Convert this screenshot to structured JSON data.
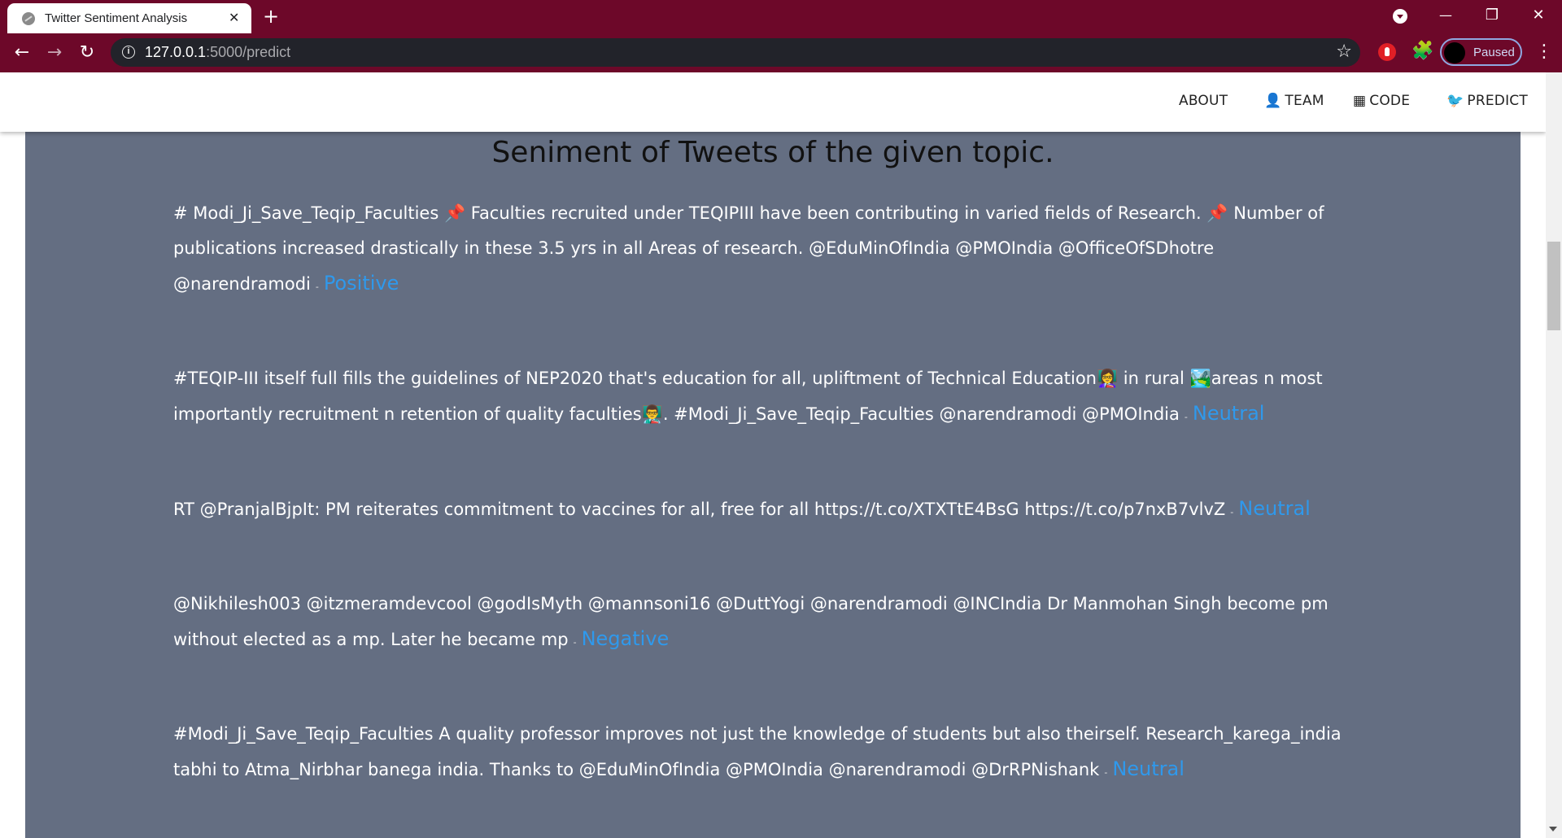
{
  "browser": {
    "tab_title": "Twitter Sentiment Analysis",
    "tab_close": "✕",
    "new_tab": "+",
    "url_host": "127.0.0.1",
    "url_path": ":5000/predict",
    "profile_label": "Paused",
    "icons": {
      "back": "←",
      "forward": "→",
      "reload": "↻",
      "star": "☆",
      "puzzle": "🧩",
      "menu": "⋮",
      "minimize": "—",
      "maximize": "❐",
      "close": "✕"
    }
  },
  "nav": {
    "about": "ABOUT",
    "team": "TEAM",
    "code": "CODE",
    "predict": "PREDICT",
    "icons": {
      "team": "👤",
      "code": "▦",
      "predict": "🐦"
    }
  },
  "page": {
    "heading": "Seniment of Tweets of the given topic."
  },
  "tweets": [
    {
      "text": "# Modi_Ji_Save_Teqip_Faculties 📌 Faculties recruited under TEQIPIII have been contributing in varied fields of Research. 📌 Number of publications increased drastically in these 3.5 yrs in all Areas of research. @EduMinOfIndia @PMOIndia @OfficeOfSDhotre @narendramodi",
      "sentiment": "Positive"
    },
    {
      "text": "#TEQIP-III itself full fills the guidelines of NEP2020 that's education for all, upliftment of Technical Education👩‍🏫 in rural 🏞️areas n most importantly recruitment n retention of quality faculties👨‍🏫. #Modi_Ji_Save_Teqip_Faculties @narendramodi @PMOIndia",
      "sentiment": "Neutral"
    },
    {
      "text": "RT @PranjalBjpIt: PM reiterates commitment to vaccines for all, free for all https://t.co/XTXTtE4BsG https://t.co/p7nxB7vlvZ",
      "sentiment": "Neutral"
    },
    {
      "text": "@Nikhilesh003 @itzmeramdevcool @godIsMyth @mannsoni16 @DuttYogi @narendramodi @INCIndia Dr Manmohan Singh become pm without elected as a mp. Later he became mp",
      "sentiment": "Negative"
    },
    {
      "text": "#Modi_Ji_Save_Teqip_Faculties A quality professor improves not just the knowledge of students but also theirself. Research_karega_india tabhi to Atma_Nirbhar banega india. Thanks to @EduMinOfIndia @PMOIndia @narendramodi @DrRPNishank",
      "sentiment": "Neutral"
    }
  ],
  "separator": "-",
  "colors": {
    "chrome": "#6d0829",
    "content_bg": "#646e82",
    "sentiment": "#2f99ec"
  }
}
